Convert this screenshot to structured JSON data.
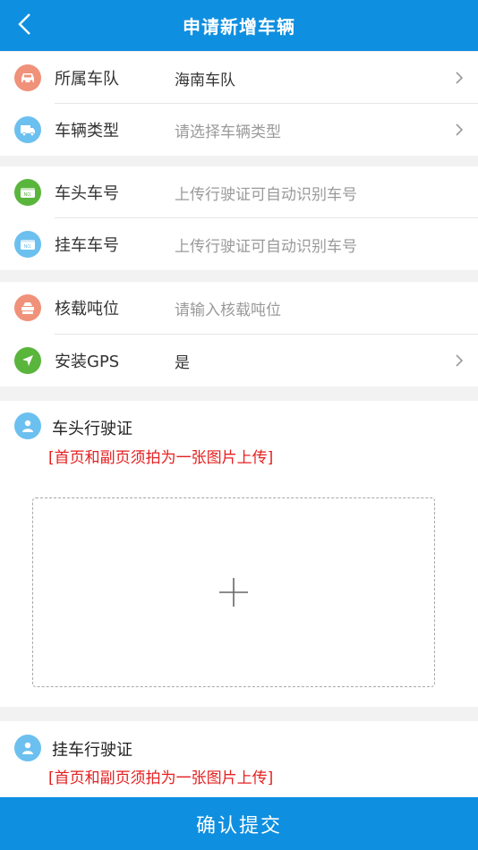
{
  "header": {
    "title": "申请新增车辆"
  },
  "rows": {
    "fleet": {
      "label": "所属车队",
      "value": "海南车队"
    },
    "vehicle_type": {
      "label": "车辆类型",
      "placeholder": "请选择车辆类型"
    },
    "head_plate": {
      "label": "车头车号",
      "placeholder": "上传行驶证可自动识别车号"
    },
    "trailer_plate": {
      "label": "挂车车号",
      "placeholder": "上传行驶证可自动识别车号"
    },
    "tonnage": {
      "label": "核载吨位",
      "placeholder": "请输入核载吨位"
    },
    "gps": {
      "label": "安装GPS",
      "value": "是"
    }
  },
  "uploads": {
    "head_license": {
      "label": "车头行驶证",
      "note": "[首页和副页须拍为一张图片上传]"
    },
    "trailer_license": {
      "label": "挂车行驶证",
      "note": "[首页和副页须拍为一张图片上传]"
    }
  },
  "submit_label": "确认提交",
  "colors": {
    "primary": "#0f8fe0",
    "fleet_icon": "#f0917a",
    "type_icon": "#6cc0ef",
    "head_plate_icon": "#5ab53c",
    "trailer_plate_icon": "#6cc0ef",
    "tonnage_icon": "#f0917a",
    "gps_icon": "#5ab53c",
    "warning": "#e52020"
  }
}
